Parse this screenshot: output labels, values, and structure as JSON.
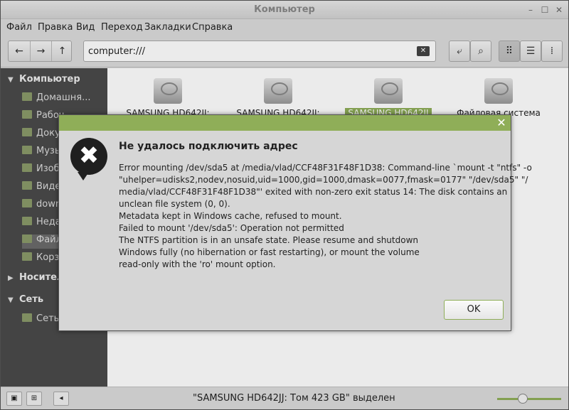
{
  "window": {
    "title": "Компьютер"
  },
  "menu": [
    "Файл",
    "Правка",
    "Вид",
    "Переход",
    "Закладки",
    "Справка"
  ],
  "location": {
    "value": "computer:///"
  },
  "sidebar": {
    "computer": {
      "label": "Компьютер",
      "items": [
        "Домашня...",
        "Рабоч",
        "Доку",
        "Музы",
        "Изоб",
        "Виде",
        "down",
        "Неда",
        "Файл",
        "Корзи"
      ]
    },
    "devices": {
      "label": "Носител"
    },
    "network": {
      "label": "Сеть",
      "items": [
        "Сеть"
      ]
    }
  },
  "drives": [
    "SAMSUNG HD642JJ:",
    "SAMSUNG HD642JJ:",
    "SAMSUNG HD642JJ",
    "Файловая система"
  ],
  "status": {
    "text": "\"SAMSUNG HD642JJ: Том 423 GB\" выделен"
  },
  "zoom": {
    "level": 0.4
  },
  "dialog": {
    "heading": "Не удалось подключить адрес",
    "lines": [
      "Error mounting /dev/sda5 at /media/vlad/CCF48F31F48F1D38: Command-line `mount -t \"ntfs\" -o",
      "\"uhelper=udisks2,nodev,nosuid,uid=1000,gid=1000,dmask=0077,fmask=0177\" \"/dev/sda5\" \"/",
      "media/vlad/CCF48F31F48F1D38\"' exited with non-zero exit status 14: The disk contains an",
      "unclean file system (0, 0).",
      "Metadata kept in Windows cache, refused to mount.",
      "Failed to mount '/dev/sda5': Operation not permitted",
      "The NTFS partition is in an unsafe state. Please resume and shutdown",
      "Windows fully (no hibernation or fast restarting), or mount the volume",
      "read-only with the 'ro' mount option."
    ],
    "ok_label": "OK"
  },
  "colors": {
    "accent": "#8fae58",
    "sidebar_bg": "#4a4a4a"
  }
}
